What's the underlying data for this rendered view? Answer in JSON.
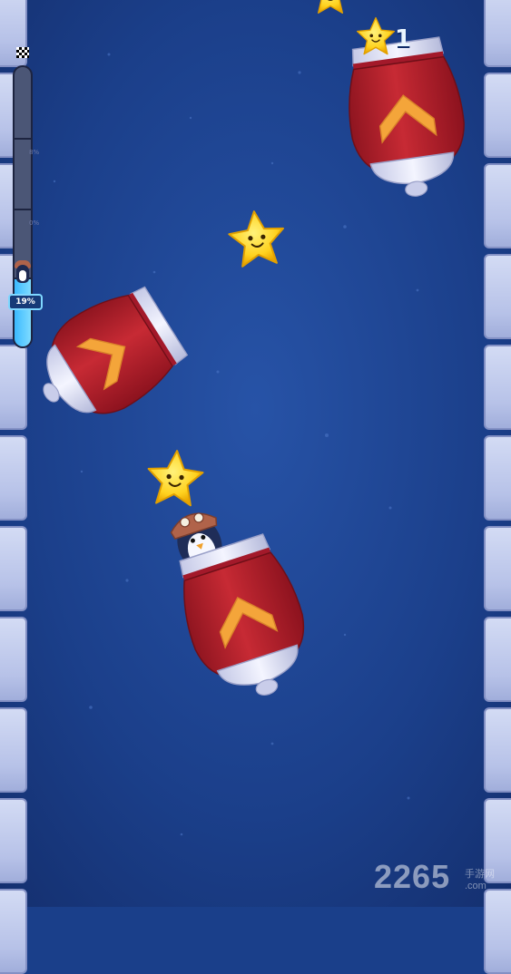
{
  "hud": {
    "score": "1",
    "progress_label": "19%",
    "progress_fraction": 0.19,
    "meter_ticks": [
      "8%",
      "0%"
    ]
  },
  "watermark": {
    "text": "2265",
    "suffix": "手游网 .com"
  },
  "colors": {
    "background": "#1a3f8a",
    "cannon_red": "#b71f2a",
    "cannon_white": "#eef0fb",
    "chevron": "#f4a53a",
    "star": "#ffd21f",
    "progress": "#4cc6ff"
  },
  "objects": [
    {
      "type": "cannon",
      "name": "cannon-top-right"
    },
    {
      "type": "cannon",
      "name": "cannon-left"
    },
    {
      "type": "cannon",
      "name": "cannon-with-penguin"
    },
    {
      "type": "star",
      "name": "star-hud"
    },
    {
      "type": "star",
      "name": "star-middle"
    },
    {
      "type": "star",
      "name": "star-lower"
    },
    {
      "type": "penguin",
      "name": "penguin-pilot"
    }
  ]
}
